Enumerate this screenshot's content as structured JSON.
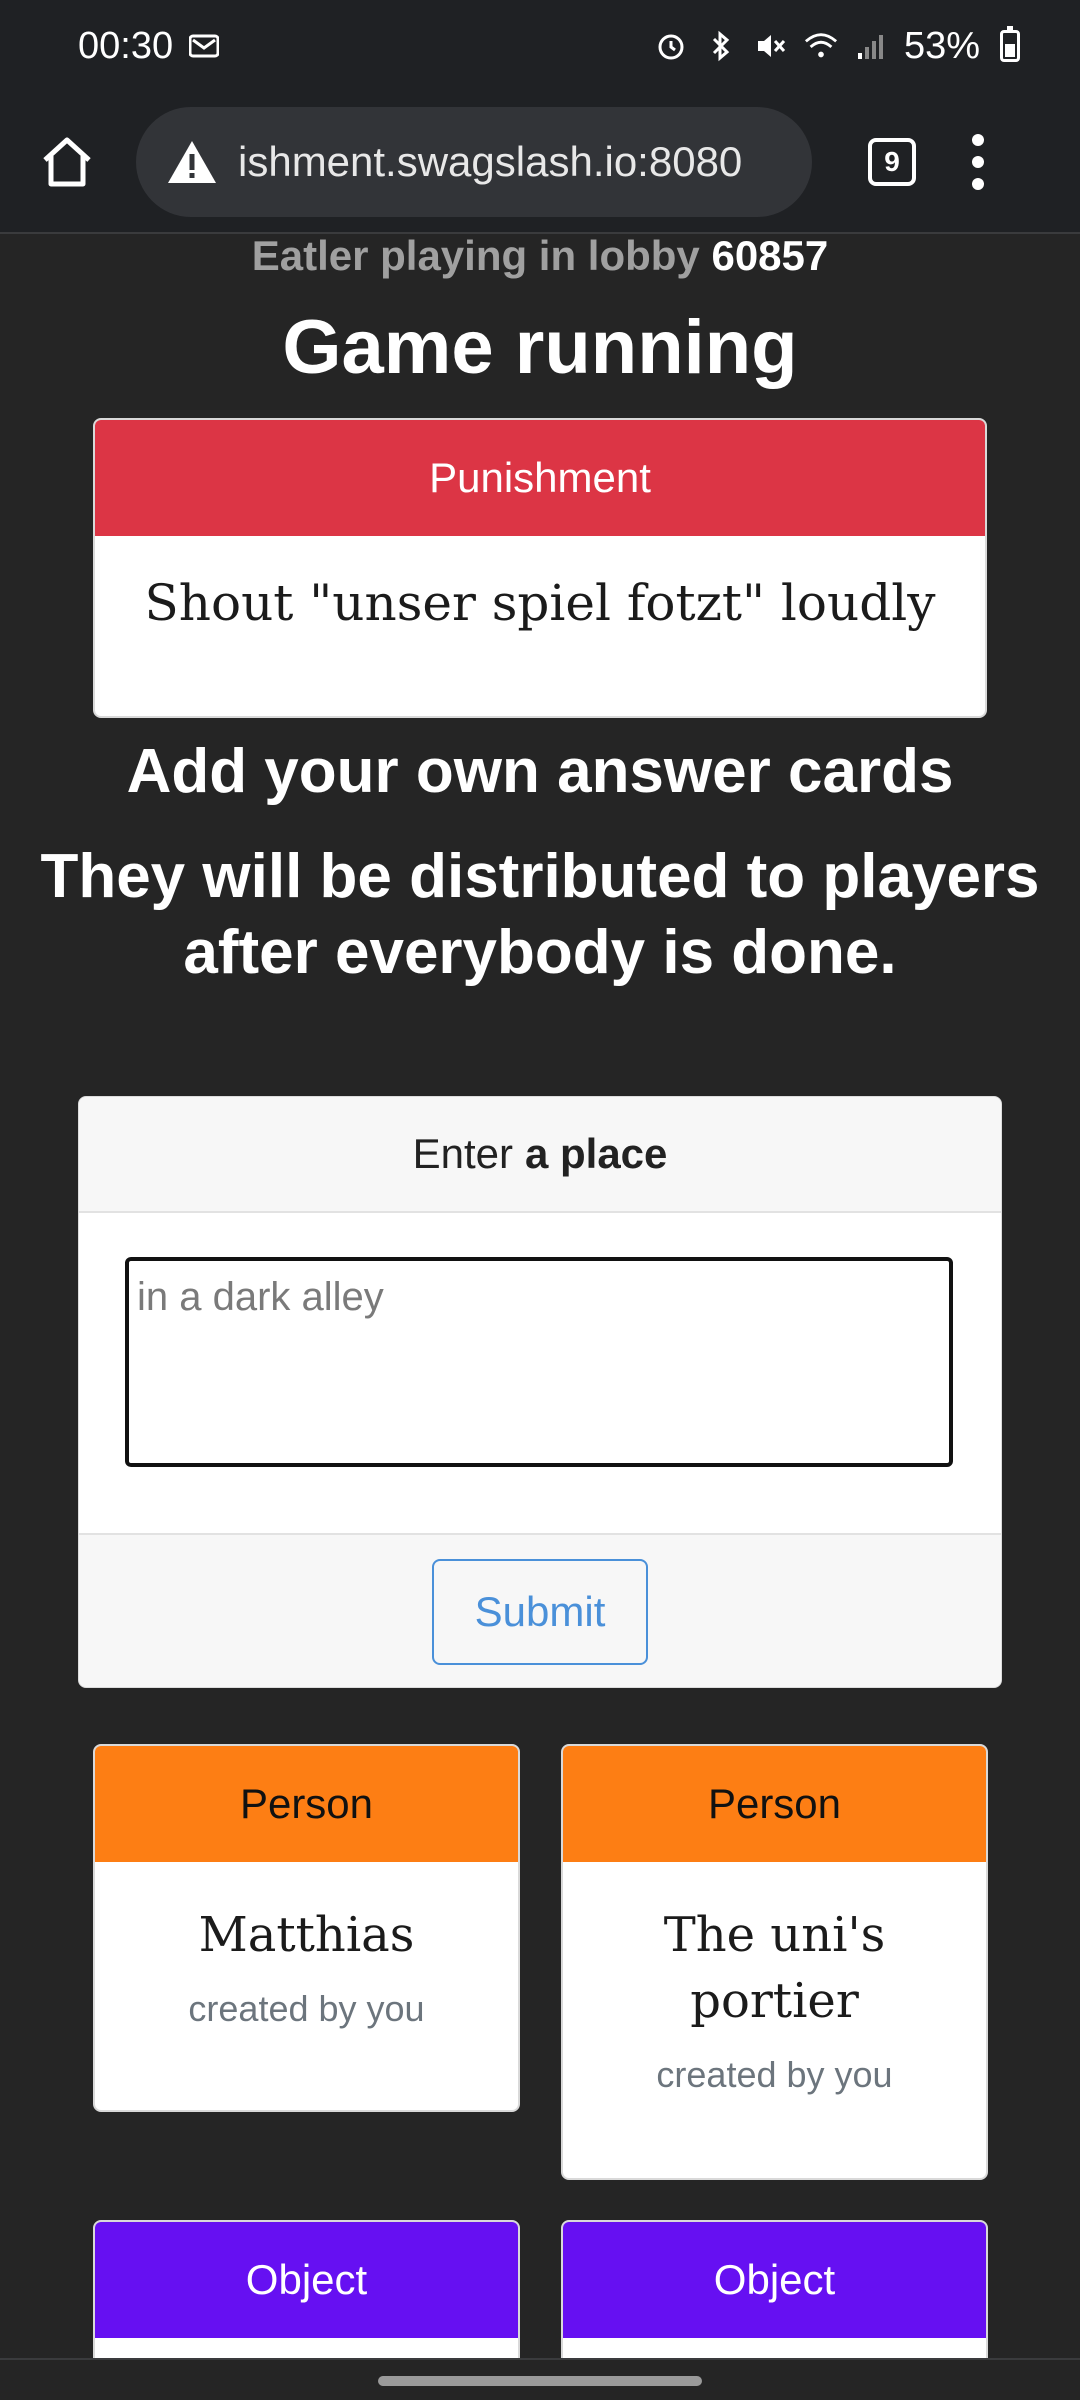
{
  "status_bar": {
    "time": "00:30",
    "battery": "53%",
    "icons": [
      "notification-icon",
      "alarm-icon",
      "bluetooth-icon",
      "mute-icon",
      "wifi-icon",
      "signal-icon",
      "battery-icon"
    ]
  },
  "browser": {
    "url": "ishment.swagslash.io:8080",
    "tab_count": "9",
    "security_icon": "warning-triangle-icon"
  },
  "lobby": {
    "prefix": "Eatler playing in lobby ",
    "code": "60857"
  },
  "game_title": "Game running",
  "punishment": {
    "header": "Punishment",
    "text": "Shout \"unser spiel fotzt\" loudly"
  },
  "section": {
    "title": "Add your own answer cards",
    "subtitle": "They will be distributed to players after everybody is done."
  },
  "form": {
    "prompt_prefix": "Enter",
    "prompt_bold": "a place",
    "placeholder": "in a dark alley",
    "value": "",
    "submit_label": "Submit"
  },
  "answer_cards": [
    {
      "category": "Person",
      "text": "Matthias",
      "meta": "created by you",
      "color": "#fd7e14"
    },
    {
      "category": "Person",
      "text": "The uni's portier",
      "meta": "created by you",
      "color": "#fd7e14"
    },
    {
      "category": "Object",
      "text": "",
      "meta": "",
      "color": "#6610f2"
    },
    {
      "category": "Object",
      "text": "",
      "meta": "",
      "color": "#6610f2"
    }
  ],
  "colors": {
    "background": "#252525",
    "punishment": "#dc3545",
    "person": "#fd7e14",
    "object": "#6610f2",
    "submit": "#4a90d9"
  }
}
